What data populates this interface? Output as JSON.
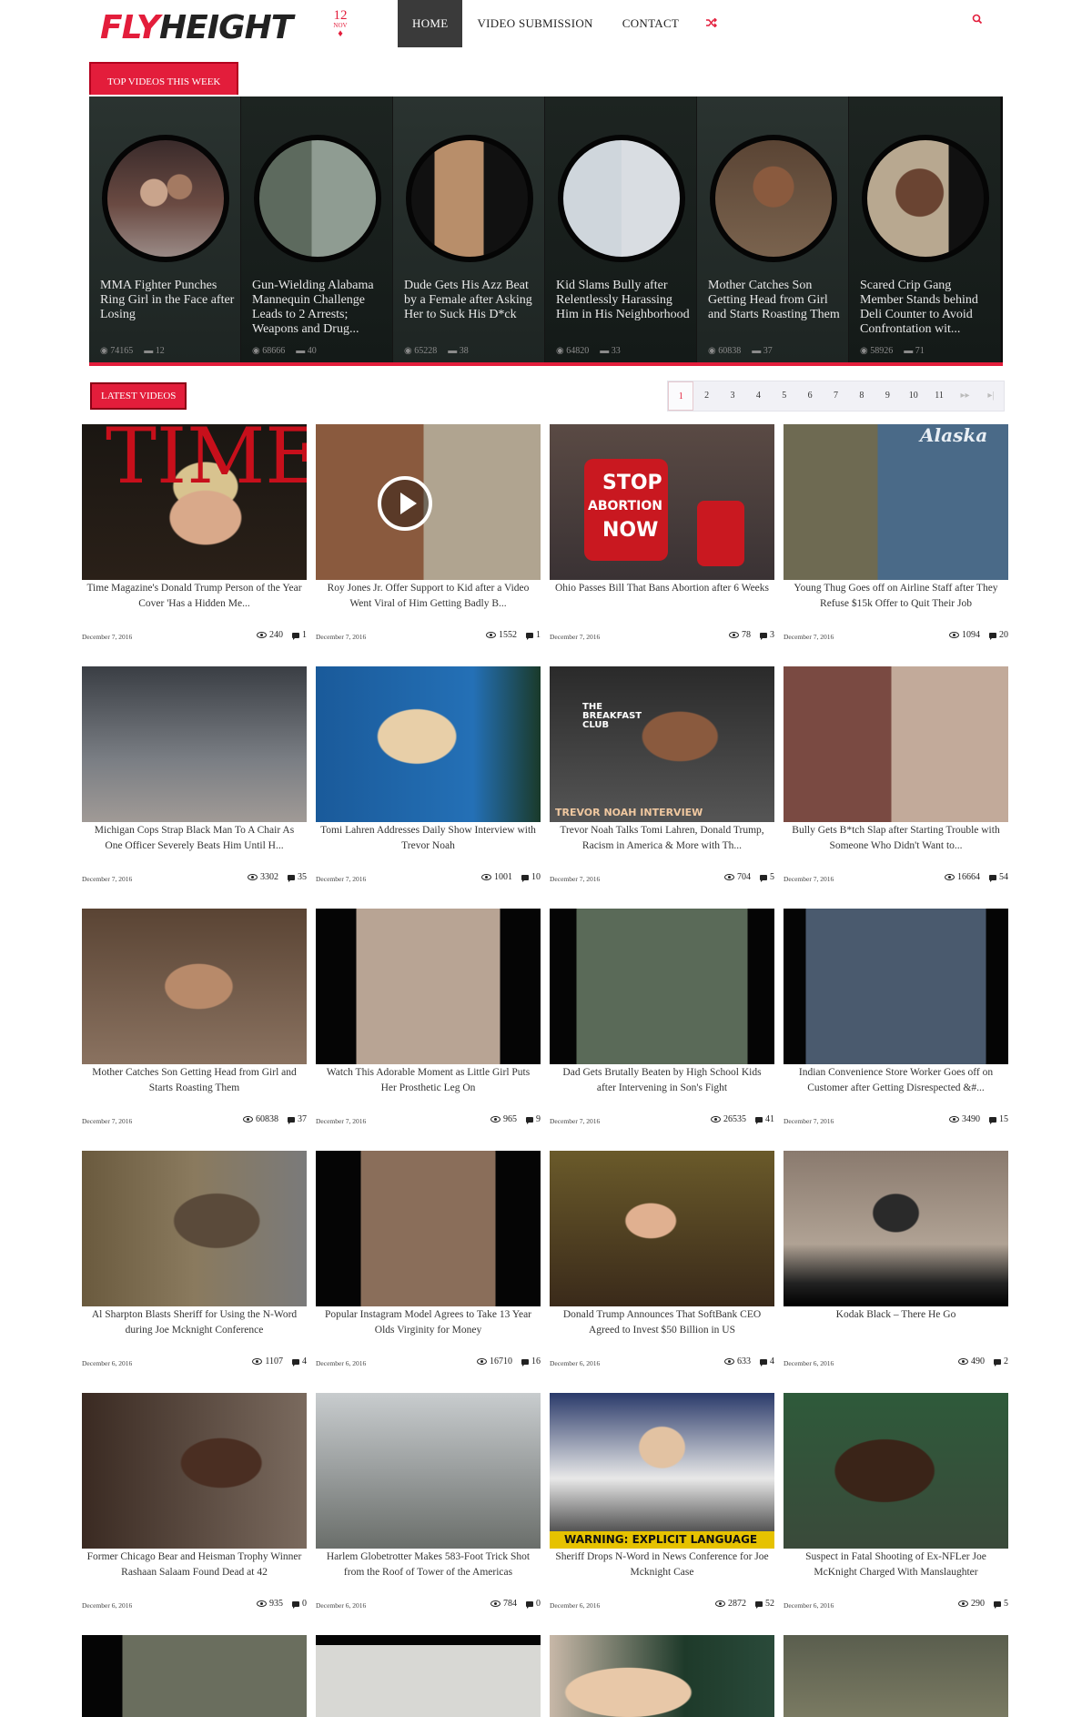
{
  "site": {
    "logo_part1": "FLY",
    "logo_part2": "HEIGHT",
    "date_day": "12",
    "date_month": "NOV",
    "brand_color": "#e31d3b"
  },
  "nav": {
    "items": [
      "HOME",
      "VIDEO SUBMISSION",
      "CONTACT"
    ],
    "random_icon": "shuffle-icon",
    "search_icon": "search-icon"
  },
  "top_videos": {
    "label": "TOP VIDEOS THIS WEEK",
    "items": [
      {
        "title": "MMA Fighter Punches Ring Girl in the Face after Losing",
        "views": "74165",
        "comments": "12"
      },
      {
        "title": "Gun-Wielding Alabama Mannequin Challenge Leads to 2 Arrests; Weapons and Drug...",
        "views": "68666",
        "comments": "40"
      },
      {
        "title": "Dude Gets His Azz Beat by a Female after Asking Her to Suck His D*ck",
        "views": "65228",
        "comments": "38"
      },
      {
        "title": "Kid Slams Bully after Relentlessly Harassing Him in His Neighborhood",
        "views": "64820",
        "comments": "33"
      },
      {
        "title": "Mother Catches Son Getting Head from Girl and Starts Roasting Them",
        "views": "60838",
        "comments": "37"
      },
      {
        "title": "Scared Crip Gang Member Stands behind Deli Counter to Avoid Confrontation wit...",
        "views": "58926",
        "comments": "71"
      }
    ]
  },
  "latest": {
    "label": "LATEST VIDEOS",
    "pages": [
      "1",
      "2",
      "3",
      "4",
      "5",
      "6",
      "7",
      "8",
      "9",
      "10",
      "11",
      "▸▸",
      "▸|"
    ],
    "videos": [
      {
        "title": "Time Magazine's Donald Trump Person of the Year Cover 'Has a Hidden Me...",
        "date": "December 7, 2016",
        "views": "240",
        "comments": "1"
      },
      {
        "title": "Roy Jones Jr. Offer Support to Kid after a Video Went Viral of Him Getting Badly B...",
        "date": "December 7, 2016",
        "views": "1552",
        "comments": "1"
      },
      {
        "title": "Ohio Passes Bill That Bans Abortion after 6 Weeks",
        "date": "December 7, 2016",
        "views": "78",
        "comments": "3"
      },
      {
        "title": "Young Thug Goes off on Airline Staff after They Refuse $15k Offer to Quit Their Job",
        "date": "December 7, 2016",
        "views": "1094",
        "comments": "20"
      },
      {
        "title": "Michigan Cops Strap Black Man To A Chair As One Officer Severely Beats Him Until H...",
        "date": "December 7, 2016",
        "views": "3302",
        "comments": "35"
      },
      {
        "title": "Tomi Lahren Addresses Daily Show Interview with Trevor Noah",
        "date": "December 7, 2016",
        "views": "1001",
        "comments": "10"
      },
      {
        "title": "Trevor Noah Talks Tomi Lahren, Donald Trump, Racism in America & More with Th...",
        "date": "December 7, 2016",
        "views": "704",
        "comments": "5"
      },
      {
        "title": "Bully Gets B*tch Slap after Starting Trouble with Someone Who Didn't Want to...",
        "date": "December 7, 2016",
        "views": "16664",
        "comments": "54"
      },
      {
        "title": "Mother Catches Son Getting Head from Girl and Starts Roasting Them",
        "date": "December 7, 2016",
        "views": "60838",
        "comments": "37"
      },
      {
        "title": "Watch This Adorable Moment as Little Girl Puts Her Prosthetic Leg On",
        "date": "December 7, 2016",
        "views": "965",
        "comments": "9"
      },
      {
        "title": "Dad Gets Brutally Beaten by High School Kids after Intervening in Son's Fight",
        "date": "December 7, 2016",
        "views": "26535",
        "comments": "41"
      },
      {
        "title": "Indian Convenience Store Worker Goes off on Customer after Getting Disrespected &#...",
        "date": "December 7, 2016",
        "views": "3490",
        "comments": "15"
      },
      {
        "title": "Al Sharpton Blasts Sheriff for Using the N-Word during Joe Mcknight Conference",
        "date": "December 6, 2016",
        "views": "1107",
        "comments": "4"
      },
      {
        "title": "Popular Instagram Model Agrees to Take 13 Year Olds Virginity for Money",
        "date": "December 6, 2016",
        "views": "16710",
        "comments": "16"
      },
      {
        "title": "Donald Trump Announces That SoftBank CEO Agreed to Invest $50 Billion in US",
        "date": "December 6, 2016",
        "views": "633",
        "comments": "4"
      },
      {
        "title": "Kodak Black – There He Go",
        "date": "December 6, 2016",
        "views": "490",
        "comments": "2"
      },
      {
        "title": "Former Chicago Bear and Heisman Trophy Winner Rashaan Salaam Found Dead at 42",
        "date": "December 6, 2016",
        "views": "935",
        "comments": "0"
      },
      {
        "title": "Harlem Globetrotter Makes 583-Foot Trick Shot from the Roof of Tower of the Americas",
        "date": "December 6, 2016",
        "views": "784",
        "comments": "0"
      },
      {
        "title": "Sheriff Drops N-Word in News Conference for Joe Mcknight Case",
        "date": "December 6, 2016",
        "views": "2872",
        "comments": "52"
      },
      {
        "title": "Suspect in Fatal Shooting of Ex-NFLer Joe McKnight Charged With Manslaughter",
        "date": "December 6, 2016",
        "views": "290",
        "comments": "5"
      }
    ],
    "thumb_text": {
      "time": "TIME",
      "stop": "STOP",
      "abortion": "ABORTION",
      "now": "NOW",
      "breakfast": "THE BREAKFAST CLUB",
      "trevor": "TREVOR NOAH INTERVIEW",
      "warning": "WARNING: EXPLICIT LANGUAGE",
      "alaska": "Alaska"
    }
  }
}
